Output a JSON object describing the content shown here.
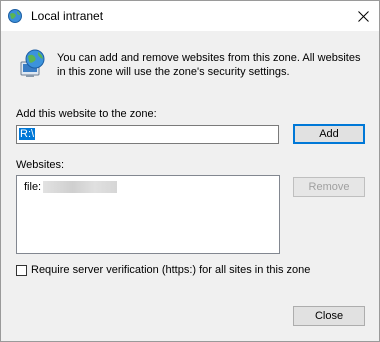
{
  "window": {
    "title": "Local intranet"
  },
  "info": {
    "text": "You can add and remove websites from this zone. All websites in this zone will use the zone's security settings."
  },
  "add_section": {
    "label": "Add this website to the zone:",
    "input_value": "R:\\",
    "add_button": "Add"
  },
  "websites": {
    "label": "Websites:",
    "items": [
      "file:"
    ],
    "remove_button": "Remove"
  },
  "options": {
    "require_https_label": "Require server verification (https:) for all sites in this zone",
    "require_https_checked": false
  },
  "footer": {
    "close_button": "Close"
  },
  "colors": {
    "accent": "#0078d7",
    "dialog_bg": "#f0f0f0"
  },
  "icons": [
    "globe-icon",
    "close-icon",
    "globe-computer-icon"
  ]
}
